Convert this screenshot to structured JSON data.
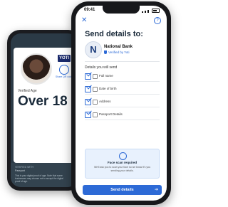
{
  "back_phone": {
    "badge": "YOTI",
    "share_label": "Share QR code",
    "verified_label": "Verified Age",
    "age_value": "Over 18",
    "verified_with_label": "VERIFIED WITH",
    "document": "Passport",
    "description": "This is your digital proof of age. Note that some businesses may choose not to accept the digital proof of age."
  },
  "front_phone": {
    "status_time": "09:41",
    "close_symbol": "✕",
    "help_symbol": "?",
    "page_title": "Send details to:",
    "bank": {
      "logo_letter": "N",
      "name": "National Bank",
      "verified_by": "Verified by Yoti"
    },
    "section_label": "Details you will send",
    "details": [
      {
        "label": "Full name",
        "icon": "person-icon"
      },
      {
        "label": "Date of birth",
        "icon": "calendar-icon"
      },
      {
        "label": "Address",
        "icon": "home-icon"
      },
      {
        "label": "Passport Details",
        "icon": "passport-icon"
      }
    ],
    "face_scan": {
      "title": "Face scan required",
      "description": "We'll ask you to scan your face so we know it's you sending your details."
    },
    "send_button_label": "Send details",
    "accent_color": "#2d6ad6"
  }
}
